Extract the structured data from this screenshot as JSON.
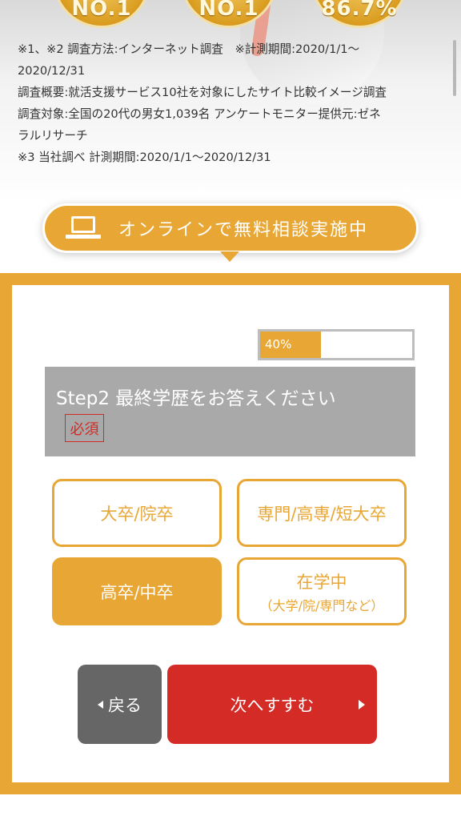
{
  "hero": {
    "badges": [
      "NO.1",
      "NO.1",
      "86.7%"
    ]
  },
  "notes": [
    "※1、※2 調査方法:インターネット調査　※計測期間:2020/1/1〜",
    "2020/12/31",
    "調査概要:就活支援サービス10社を対象にしたサイト比較イメージ調査",
    "調査対象:全国の20代の男女1,039名 アンケートモニター提供元:ゼネ",
    "ラルリサーチ",
    "※3 当社調べ 計測期間:2020/1/1〜2020/12/31"
  ],
  "online_badge": {
    "icon": "laptop-icon",
    "text": "オンラインで無料相談実施中"
  },
  "progress": {
    "label": "40%",
    "value": 0.4
  },
  "question": {
    "title": "Step2  最終学歴をお答えください",
    "required": "必須"
  },
  "options": [
    {
      "main": "大卒/院卒",
      "sub": "",
      "selected": false
    },
    {
      "main": "専門/高専/短大卒",
      "sub": "",
      "selected": false
    },
    {
      "main": "高卒/中卒",
      "sub": "",
      "selected": true
    },
    {
      "main": "在学中",
      "sub": "（大学/院/専門など）",
      "selected": false
    }
  ],
  "buttons": {
    "back": "戻る",
    "next": "次へすすむ"
  },
  "colors": {
    "accent": "#e8a634",
    "next_button": "#d52b26",
    "back_button": "#666666",
    "question_bg": "#a9a9a9",
    "required": "#d32a25"
  }
}
